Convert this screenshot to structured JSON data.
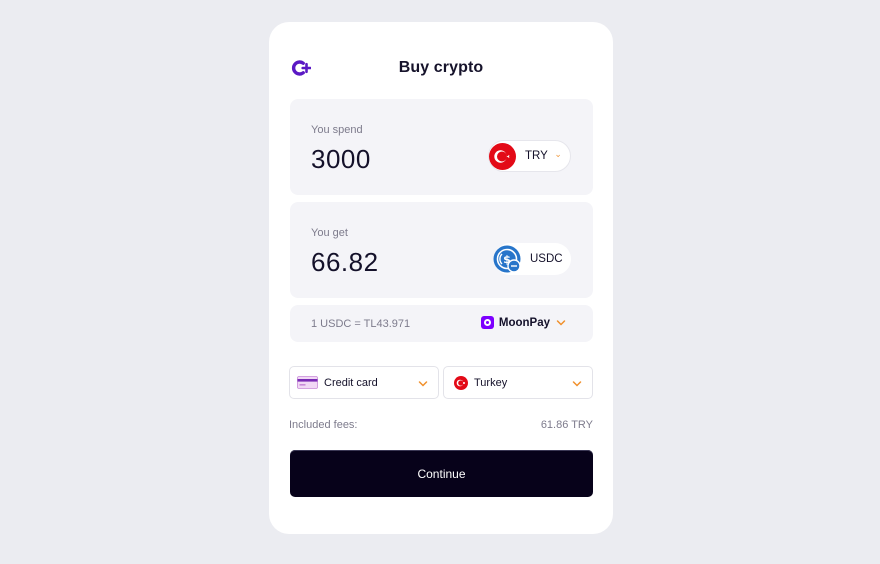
{
  "header": {
    "title": "Buy crypto",
    "logo_icon": "plus-c-logo-icon",
    "brand_color": "#5b19c4"
  },
  "spend": {
    "label": "You spend",
    "amount": "3000",
    "currency_code": "TRY",
    "currency_flag": "turkey-flag-icon"
  },
  "get": {
    "label": "You get",
    "amount": "66.82",
    "currency_code": "USDC",
    "currency_icon": "usdc-icon"
  },
  "rate": {
    "text": "1 USDC = TL43.971",
    "provider_name": "MoonPay",
    "provider_color": "#7d00ff"
  },
  "payment_method": {
    "label": "Credit card",
    "icon": "credit-card-icon"
  },
  "country": {
    "label": "Turkey",
    "icon": "turkey-flag-icon"
  },
  "fees": {
    "label": "Included fees:",
    "value": "61.86 TRY"
  },
  "continue_label": "Continue",
  "colors": {
    "accent_chevron": "#f0902c",
    "background": "#ebecf1",
    "button": "#07021a"
  }
}
